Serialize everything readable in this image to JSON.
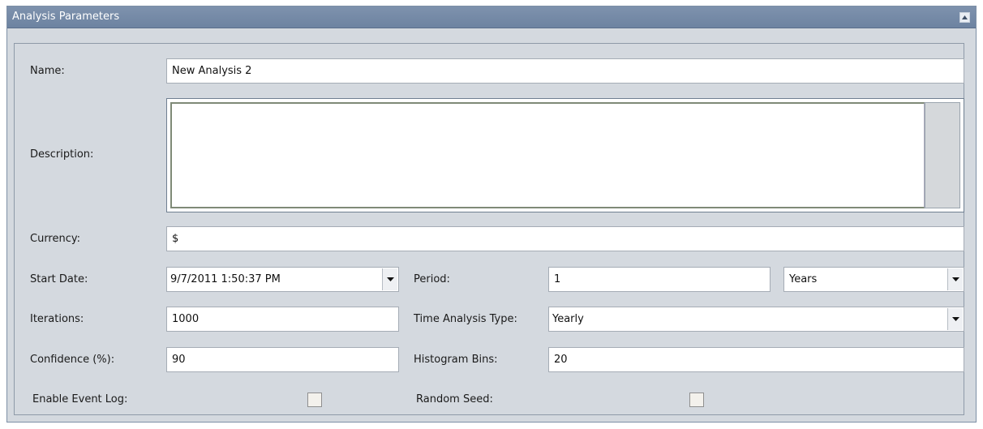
{
  "panel": {
    "title": "Analysis Parameters"
  },
  "fields": {
    "name_label": "Name:",
    "name_value": "New Analysis 2",
    "description_label": "Description:",
    "description_value": "",
    "currency_label": "Currency:",
    "currency_value": "$",
    "start_date_label": "Start Date:",
    "start_date_value": "9/7/2011 1:50:37 PM",
    "period_label": "Period:",
    "period_value": "1",
    "period_unit": "Years",
    "iterations_label": "Iterations:",
    "iterations_value": "1000",
    "time_analysis_type_label": "Time Analysis Type:",
    "time_analysis_type_value": "Yearly",
    "confidence_label": "Confidence (%):",
    "confidence_value": "90",
    "histogram_bins_label": "Histogram Bins:",
    "histogram_bins_value": "20",
    "enable_event_log_label": "Enable Event Log:",
    "enable_event_log_checked": false,
    "random_seed_label": "Random Seed:",
    "random_seed_checked": false
  },
  "icons": {
    "collapse": "collapse-up-icon",
    "dropdown": "chevron-down-icon"
  },
  "colors": {
    "titlebar": "#7387a3",
    "panel_bg": "#d4d9df"
  }
}
